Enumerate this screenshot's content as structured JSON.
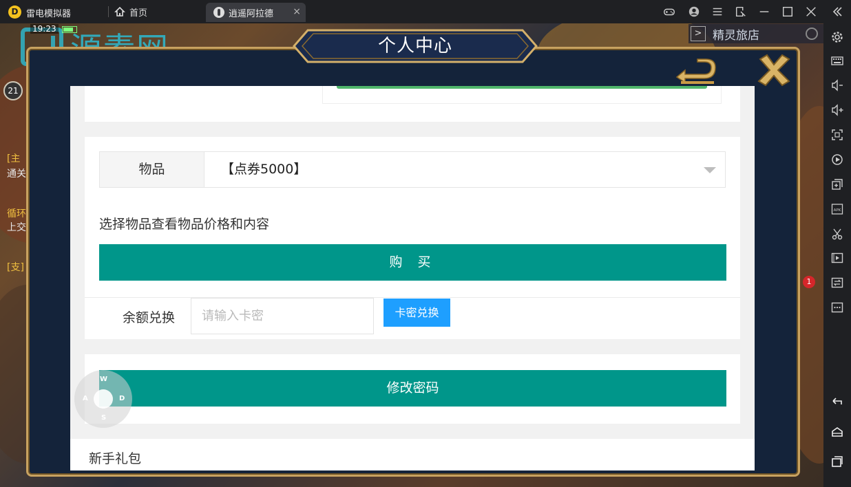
{
  "emulator": {
    "app_name": "雷电模拟器",
    "logo_glyph": "D",
    "tabs": [
      {
        "label": "首页"
      },
      {
        "label": "逍遥阿拉德"
      }
    ],
    "close_tab_glyph": "×"
  },
  "game": {
    "time": "19:23",
    "watermark": "源素网",
    "level": "21",
    "left_fragments": [
      "[主",
      "通关",
      "循环",
      "上交",
      "[支]"
    ],
    "spirit_shop": "精灵旅店",
    "spirit_arrow": ">",
    "notification_badge": "1"
  },
  "dialog": {
    "title": "个人中心"
  },
  "shop": {
    "item_label": "物品",
    "item_selected": "【点券5000】",
    "hint": "选择物品查看物品价格和内容",
    "buy_label": "购 买"
  },
  "redeem": {
    "label": "余额兑换",
    "placeholder": "请输入卡密",
    "button": "卡密兑换"
  },
  "password": {
    "button": "修改密码"
  },
  "gift": {
    "title": "新手礼包"
  },
  "joystick": {
    "keys": {
      "up": "W",
      "left": "A",
      "right": "D",
      "down": "S"
    }
  },
  "colors": {
    "primary_green": "#00968a",
    "redeem_blue": "#1e9fff",
    "frame_gold": "#c8a260",
    "watermark": "#2fb5c9"
  }
}
